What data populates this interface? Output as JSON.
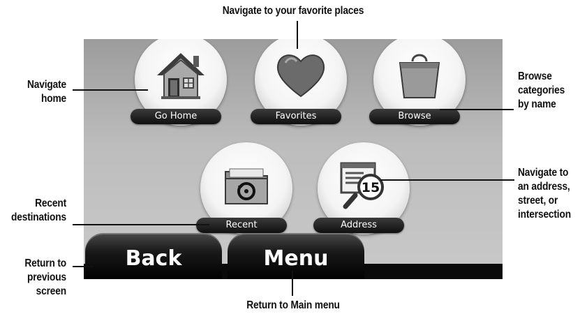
{
  "screen": {
    "tiles": [
      {
        "name": "go-home",
        "label": "Go Home",
        "icon": "house-icon"
      },
      {
        "name": "favorites",
        "label": "Favorites",
        "icon": "heart-icon"
      },
      {
        "name": "browse",
        "label": "Browse",
        "icon": "shopping-bag-icon"
      },
      {
        "name": "recent",
        "label": "Recent",
        "icon": "recent-folder-icon"
      },
      {
        "name": "address",
        "label": "Address",
        "icon": "address-magnifier-icon"
      }
    ],
    "address_icon_number": "15",
    "bottom_buttons": {
      "back": "Back",
      "menu": "Menu"
    }
  },
  "callouts": {
    "top": "Navigate to your favorite places",
    "home": [
      "Navigate",
      "home"
    ],
    "browse": [
      "Browse",
      "categories",
      "by name"
    ],
    "address": [
      "Navigate to",
      "an address,",
      "street, or",
      "intersection"
    ],
    "recent": [
      "Recent",
      "destinations"
    ],
    "back": [
      "Return to",
      "previous",
      "screen"
    ],
    "bottom": "Return to Main menu"
  },
  "colors": {
    "screen_bg": "#bdbdbd",
    "pill_bg": "#101010",
    "heart": "#6b6b6b",
    "button_bg": "#000000"
  }
}
